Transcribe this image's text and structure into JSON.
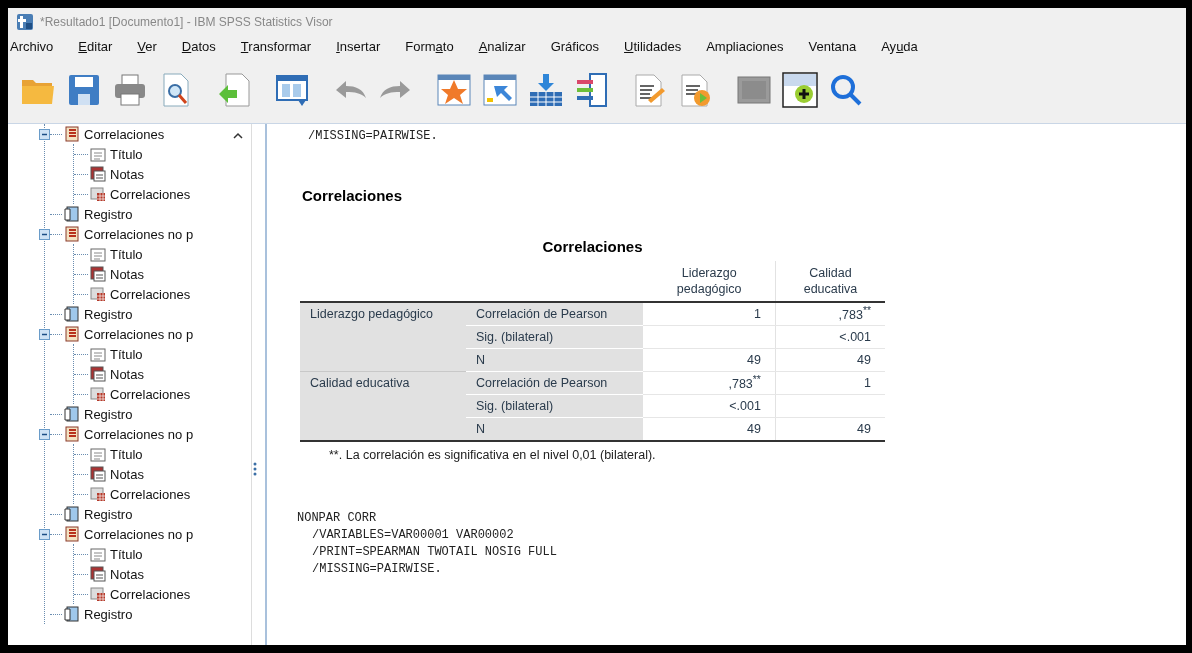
{
  "window": {
    "title": "*Resultado1 [Documento1] - IBM SPSS Statistics Visor"
  },
  "menu": [
    {
      "before": "Archivo"
    },
    {
      "key": "E",
      "after": "ditar"
    },
    {
      "key": "V",
      "after": "er"
    },
    {
      "key": "D",
      "after": "atos"
    },
    {
      "key": "T",
      "after": "ransformar"
    },
    {
      "key": "I",
      "after": "nsertar"
    },
    {
      "before": "Form",
      "key": "a",
      "after": "to"
    },
    {
      "key": "A",
      "after": "nalizar"
    },
    {
      "before": "Gráficos"
    },
    {
      "key": "U",
      "after": "tilidades"
    },
    {
      "before": "Ampliaciones"
    },
    {
      "before": "Ventana"
    },
    {
      "before": "Ay",
      "key": "u",
      "after": "da"
    }
  ],
  "toolbar": [
    {
      "kind": "open",
      "disabled": false
    },
    {
      "kind": "save",
      "disabled": false
    },
    {
      "kind": "print",
      "disabled": false
    },
    {
      "kind": "preview",
      "disabled": false
    },
    {
      "kind": "export",
      "disabled": false
    },
    {
      "kind": "data",
      "disabled": false
    },
    {
      "kind": "undo",
      "disabled": true
    },
    {
      "kind": "redo",
      "disabled": true
    },
    {
      "kind": "star",
      "disabled": false
    },
    {
      "kind": "goto",
      "disabled": false
    },
    {
      "kind": "insert",
      "disabled": false
    },
    {
      "kind": "list",
      "disabled": false
    },
    {
      "kind": "edit",
      "disabled": false
    },
    {
      "kind": "run",
      "disabled": false
    },
    {
      "kind": "square",
      "disabled": true
    },
    {
      "kind": "add",
      "disabled": false
    },
    {
      "kind": "search",
      "disabled": false
    }
  ],
  "outline": [
    {
      "label": "Correlaciones",
      "kind": "procedure",
      "expanded": true,
      "children": [
        {
          "label": "Título",
          "kind": "title"
        },
        {
          "label": "Notas",
          "kind": "notes"
        },
        {
          "label": "Correlaciones",
          "kind": "table"
        }
      ]
    },
    {
      "label": "Registro",
      "kind": "log"
    },
    {
      "label": "Correlaciones no p",
      "kind": "procedure",
      "expanded": true,
      "children": [
        {
          "label": "Título",
          "kind": "title"
        },
        {
          "label": "Notas",
          "kind": "notes"
        },
        {
          "label": "Correlaciones",
          "kind": "table"
        }
      ]
    },
    {
      "label": "Registro",
      "kind": "log"
    },
    {
      "label": "Correlaciones no p",
      "kind": "procedure",
      "expanded": true,
      "children": [
        {
          "label": "Título",
          "kind": "title"
        },
        {
          "label": "Notas",
          "kind": "notes"
        },
        {
          "label": "Correlaciones",
          "kind": "table"
        }
      ]
    },
    {
      "label": "Registro",
      "kind": "log"
    },
    {
      "label": "Correlaciones no p",
      "kind": "procedure",
      "expanded": true,
      "children": [
        {
          "label": "Título",
          "kind": "title"
        },
        {
          "label": "Notas",
          "kind": "notes"
        },
        {
          "label": "Correlaciones",
          "kind": "table"
        }
      ]
    },
    {
      "label": "Registro",
      "kind": "log"
    },
    {
      "label": "Correlaciones no p",
      "kind": "procedure",
      "expanded": true,
      "children": [
        {
          "label": "Título",
          "kind": "title"
        },
        {
          "label": "Notas",
          "kind": "notes"
        },
        {
          "label": "Correlaciones",
          "kind": "table"
        }
      ]
    },
    {
      "label": "Registro",
      "kind": "log"
    }
  ],
  "output": [
    {
      "kind": "syntax",
      "lines": [
        {
          "text": "/MISSING=PAIRWISE.",
          "indent": true
        }
      ]
    },
    {
      "kind": "heading",
      "text": "Correlaciones"
    },
    {
      "kind": "pivot",
      "title": "Correlaciones",
      "columns": [
        "Liderazgo pedagógico",
        "Calidad educativa"
      ],
      "groups": [
        {
          "label": "Liderazgo pedagógico",
          "rows": [
            {
              "stat": "Correlación de Pearson",
              "values": {
                "col_1": "1",
                "col_2": ",783$^{**}$"
              }
            },
            {
              "stat": "Sig. (bilateral)",
              "values": {
                "col_2": "<.001"
              }
            },
            {
              "stat": "N",
              "values": {
                "col_1": "49",
                "col_2": "49"
              }
            }
          ]
        },
        {
          "label": "Calidad educativa",
          "rows": [
            {
              "stat": "Correlación de Pearson",
              "values": {
                "col_1": ",783$^{**}$",
                "col_2": "1"
              }
            },
            {
              "stat": "Sig. (bilateral)",
              "values": {
                "col_1": "<.001"
              }
            },
            {
              "stat": "N",
              "values": {
                "col_1": "49",
                "col_2": "49"
              }
            }
          ]
        }
      ],
      "footnote": "**. La correlación es significativa en el nivel 0,01 (bilateral)."
    },
    {
      "kind": "syntax",
      "lines": [
        {
          "text": "NONPAR CORR",
          "indent": false
        },
        {
          "text": "/VARIABLES=VAR00001 VAR00002",
          "indent": true
        },
        {
          "text": "/PRINT=SPEARMAN TWOTAIL NOSIG FULL",
          "indent": true
        },
        {
          "text": "/MISSING=PAIRWISE.",
          "indent": true
        }
      ]
    }
  ]
}
